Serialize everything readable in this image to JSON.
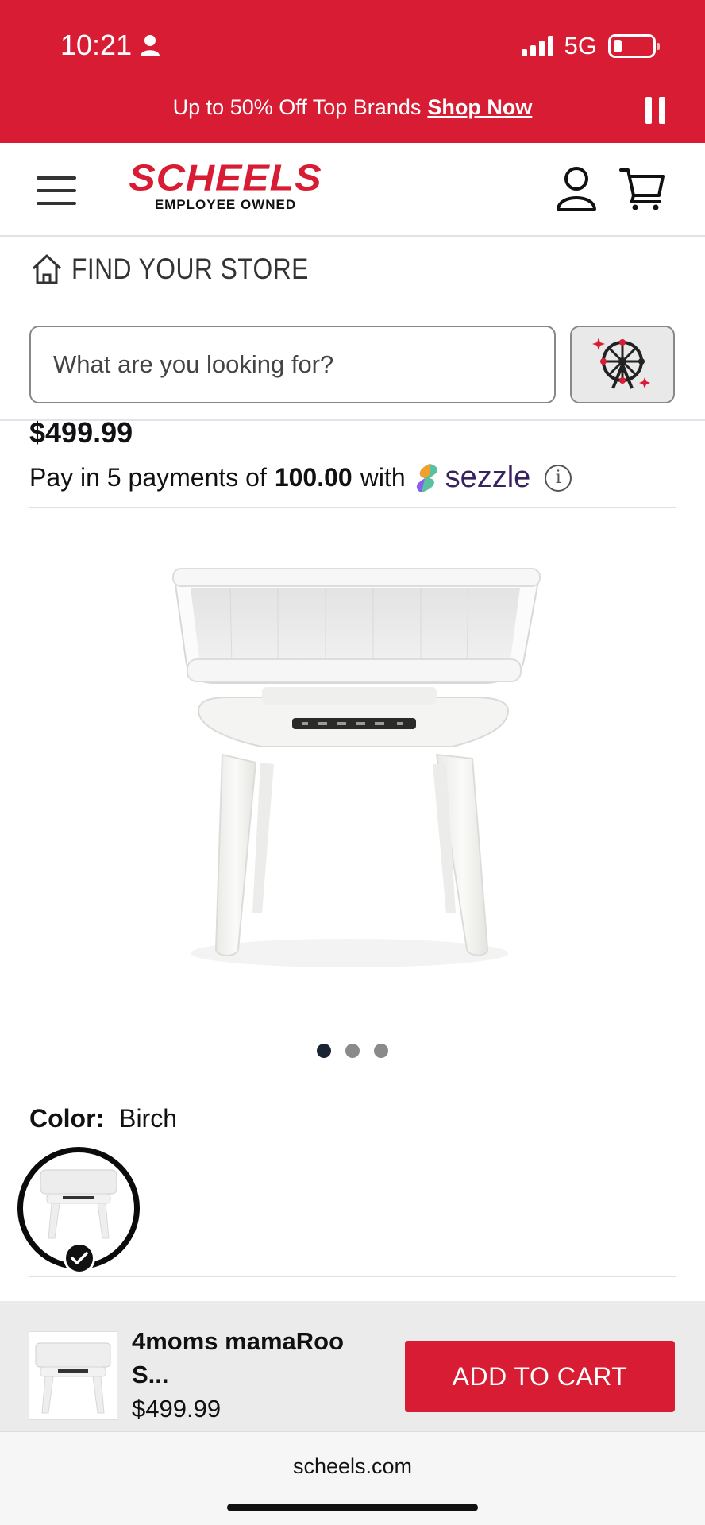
{
  "status_bar": {
    "time": "10:21",
    "network": "5G"
  },
  "promo": {
    "text": "Up to 50% Off Top Brands",
    "link": "Shop Now"
  },
  "header": {
    "logo": "SCHEELS",
    "logo_sub": "EMPLOYEE OWNED"
  },
  "find_store": {
    "label": "FIND YOUR STORE"
  },
  "search": {
    "placeholder": "What are you looking for?"
  },
  "product": {
    "price": "$499.99",
    "sezzle": {
      "prefix": "Pay in 5 payments of",
      "amount": "100.00",
      "suffix": "with",
      "brand": "sezzle"
    },
    "image_dots": {
      "count": 3,
      "active_index": 0
    },
    "color": {
      "label": "Color:",
      "value": "Birch"
    }
  },
  "sticky": {
    "name": "4moms mamaRoo S...",
    "price": "$499.99",
    "button": "ADD TO CART"
  },
  "browser": {
    "url": "scheels.com"
  },
  "colors": {
    "brand_red": "#d71c33",
    "sezzle_purple": "#38215f"
  }
}
